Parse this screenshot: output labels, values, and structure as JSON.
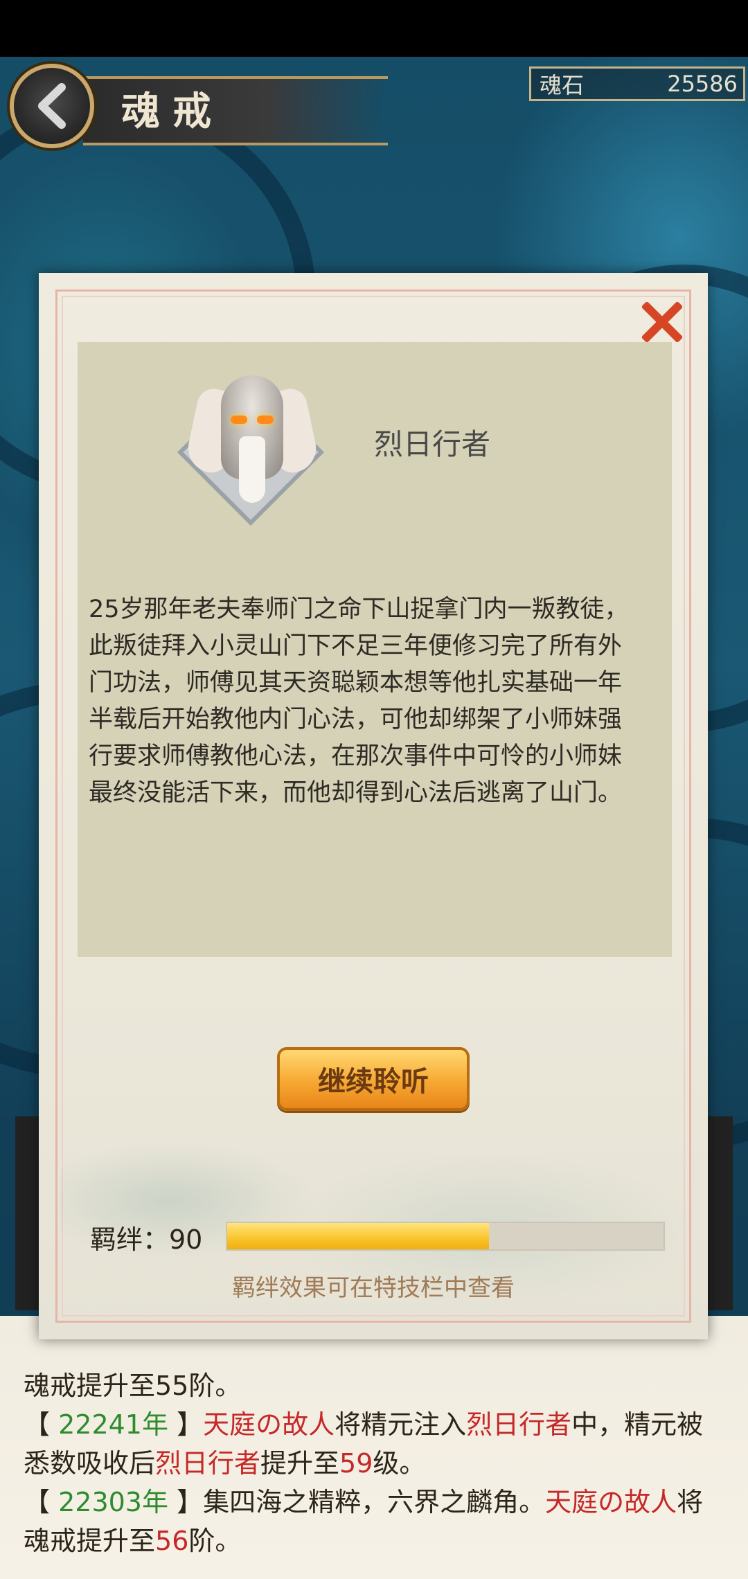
{
  "header": {
    "title": "魂戒",
    "currency_label": "魂石",
    "currency_value": "25586"
  },
  "dialog": {
    "character_name": "烈日行者",
    "story": "25岁那年老夫奉师门之命下山捉拿门内一叛教徒，此叛徒拜入小灵山门下不足三年便修习完了所有外门功法，师傅见其天资聪颖本想等他扎实基础一年半载后开始教他内门心法，可他却绑架了小师妹强行要求师傅教他心法，在那次事件中可怜的小师妹最终没能活下来，而他却得到心法后逃离了山门。",
    "continue_label": "继续聆听",
    "bond_label": "羁绊：90",
    "bond_progress": 0.6,
    "bond_note": "羁绊效果可在特技栏中查看"
  },
  "log": {
    "line1_end": "魂戒提升至55阶。",
    "entry2_year": "22241年",
    "entry2_user": "天庭の故人",
    "entry2_mid": "将精元注入",
    "entry2_char": "烈日行者",
    "entry2_tail": "中，精元被",
    "entry2_line2_a": "悉数吸收后",
    "entry2_line2_char": "烈日行者",
    "entry2_line2_b": "提升至",
    "entry2_level": "59",
    "entry2_line2_c": "级。",
    "entry3_year": "22303年",
    "entry3_text": "集四海之精粹，六界之麟角。",
    "entry3_user": "天庭の故人",
    "entry3_tail": "将",
    "entry3_line2_a": "魂戒提升至",
    "entry3_level": "56",
    "entry3_line2_b": "阶。"
  },
  "colors": {
    "accent_orange": "#f7a832",
    "log_green": "#2e8b2e",
    "log_red": "#c62828"
  }
}
